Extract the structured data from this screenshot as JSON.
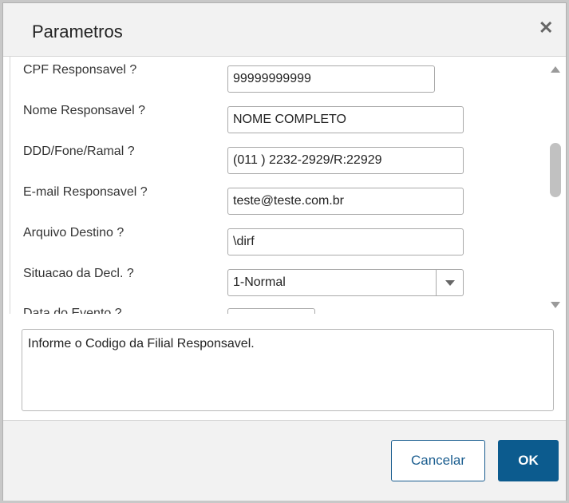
{
  "dialog": {
    "title": "Parametros",
    "close_icon": "close-icon"
  },
  "form": {
    "fields": [
      {
        "label": "CPF Responsavel ?",
        "value": "99999999999"
      },
      {
        "label": "Nome Responsavel ?",
        "value": "NOME COMPLETO"
      },
      {
        "label": "DDD/Fone/Ramal ?",
        "value": "(011 ) 2232-2929/R:22929"
      },
      {
        "label": "E-mail Responsavel ?",
        "value": "teste@teste.com.br"
      },
      {
        "label": "Arquivo Destino ?",
        "value": "\\dirf"
      },
      {
        "label": "Situacao da Decl. ?",
        "value": "1-Normal"
      },
      {
        "label": "Data do Evento ?",
        "value": ""
      }
    ]
  },
  "help": {
    "text": "Informe o Codigo da Filial Responsavel."
  },
  "footer": {
    "cancel_label": "Cancelar",
    "ok_label": "OK"
  },
  "colors": {
    "primary": "#0c5b8e",
    "header_bg": "#f2f2f2"
  }
}
